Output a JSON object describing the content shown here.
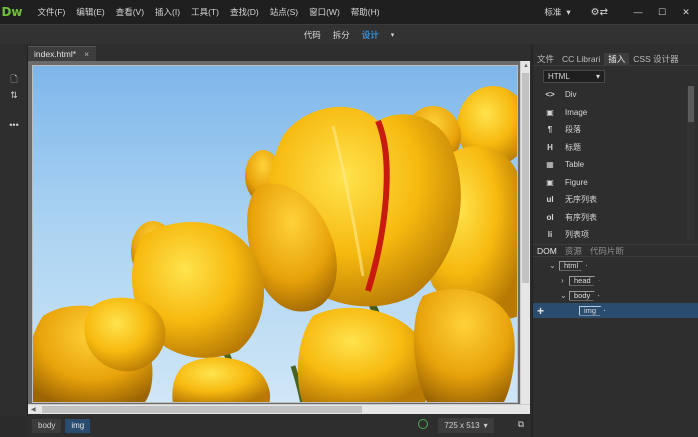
{
  "app": {
    "logo": "Dw"
  },
  "menu": [
    "文件(F)",
    "编辑(E)",
    "查看(V)",
    "插入(I)",
    "工具(T)",
    "查找(D)",
    "站点(S)",
    "窗口(W)",
    "帮助(H)"
  ],
  "workspace": {
    "label": "标准",
    "caret": "▾"
  },
  "window_controls": {
    "minimize": "—",
    "maximize": "☐",
    "close": "✕"
  },
  "view_modes": {
    "code": "代码",
    "split": "拆分",
    "design": "设计",
    "dropdown": "▾",
    "active": "design"
  },
  "left_tools": {
    "file": "🗋",
    "sort": "⇅",
    "more": "•••"
  },
  "document": {
    "tab_name": "index.html*",
    "close": "×"
  },
  "status": {
    "breadcrumbs": [
      "body",
      "img"
    ],
    "selected_crumb": "img",
    "size": "725 x 513",
    "size_caret": "▾"
  },
  "panel": {
    "tabs": [
      "文件",
      "CC Librari",
      "插入",
      "CSS 设计器"
    ],
    "active_tab": "插入",
    "category": "HTML",
    "category_caret": "▾",
    "insert_items": [
      {
        "icon": "<>",
        "label": "Div"
      },
      {
        "icon": "▣",
        "label": "Image"
      },
      {
        "icon": "¶",
        "label": "段落"
      },
      {
        "icon": "H",
        "label": "标题",
        "has_submenu": true
      },
      {
        "icon": "▦",
        "label": "Table"
      },
      {
        "icon": "▣",
        "label": "Figure"
      },
      {
        "icon": "ul",
        "label": "无序列表"
      },
      {
        "icon": "ol",
        "label": "有序列表"
      },
      {
        "icon": "li",
        "label": "列表项"
      }
    ],
    "dom_tabs": [
      "DOM",
      "资源",
      "代码片断"
    ],
    "dom_active": "DOM",
    "dom_tree": [
      {
        "tag": "html",
        "expanded": true
      },
      {
        "tag": "head",
        "expanded": false
      },
      {
        "tag": "body",
        "expanded": true
      },
      {
        "tag": "img",
        "selected": true
      }
    ],
    "add_symbol": "+"
  },
  "colors": {
    "accent": "#2f8fe0",
    "logo": "#6fbf3a",
    "selection": "#2a4c6e",
    "petal": "#f2b40c",
    "sky": "#7eb6ea"
  },
  "canvas": {
    "content": "yellow tulips against blue sky (img)"
  }
}
